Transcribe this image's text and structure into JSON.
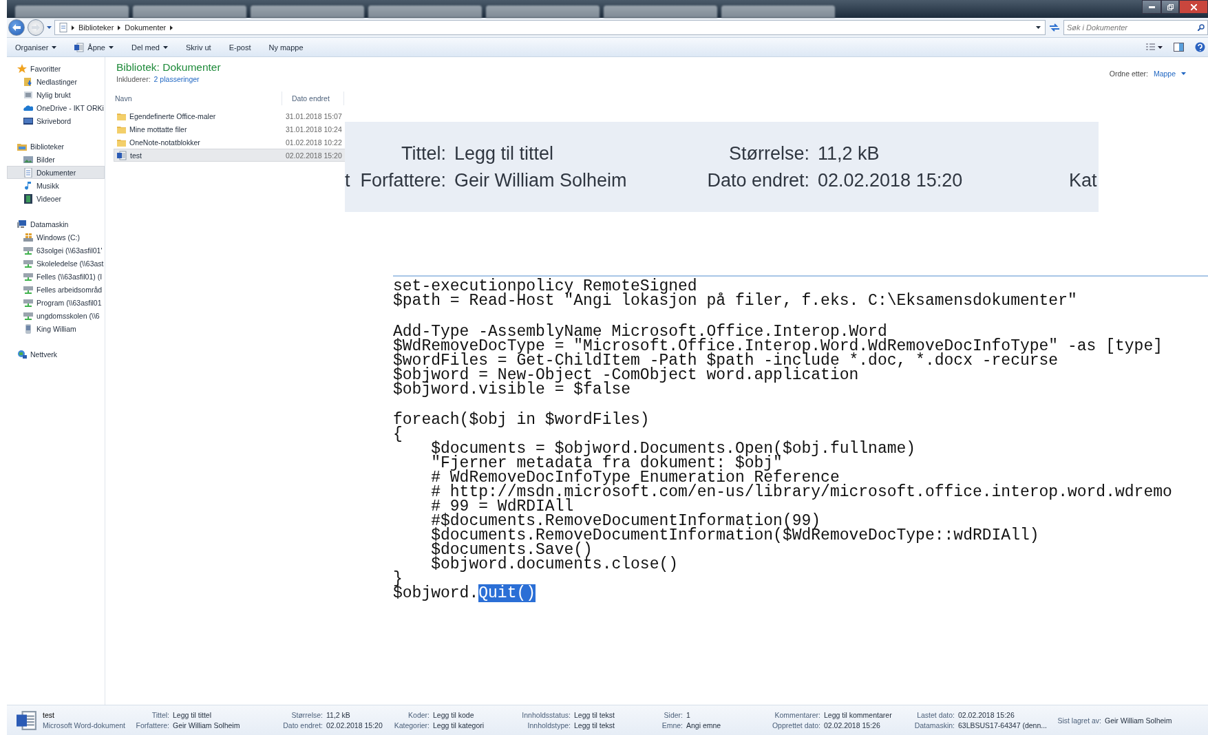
{
  "address_bar": {
    "breadcrumbs": [
      "Biblioteker",
      "Dokumenter"
    ],
    "search": {
      "placeholder": "Søk i Dokumenter"
    }
  },
  "toolbar": {
    "buttons": [
      {
        "label": "Organiser",
        "kind": "menu"
      },
      {
        "label": "Åpne",
        "kind": "app-menu"
      },
      {
        "label": "Del med",
        "kind": "menu"
      },
      {
        "label": "Skriv ut",
        "kind": "plain"
      },
      {
        "label": "E-post",
        "kind": "plain"
      },
      {
        "label": "Ny mappe",
        "kind": "plain"
      }
    ]
  },
  "sidebar": {
    "groups": [
      {
        "label": "Favoritter",
        "kind": "favorites",
        "children": [
          {
            "label": "Nedlastinger",
            "kind": "downloads",
            "selected": false
          },
          {
            "label": "Nylig brukt",
            "kind": "recent",
            "selected": false
          },
          {
            "label": "OneDrive - IKT ORKi",
            "kind": "cloud",
            "selected": false
          },
          {
            "label": "Skrivebord",
            "kind": "desktop",
            "selected": false
          }
        ]
      },
      {
        "label": "Biblioteker",
        "kind": "libraries",
        "children": [
          {
            "label": "Bilder",
            "kind": "pictures",
            "selected": false
          },
          {
            "label": "Dokumenter",
            "kind": "documents",
            "selected": true
          },
          {
            "label": "Musikk",
            "kind": "music",
            "selected": false
          },
          {
            "label": "Videoer",
            "kind": "videos",
            "selected": false
          }
        ]
      },
      {
        "label": "Datamaskin",
        "kind": "computer",
        "children": [
          {
            "label": "Windows (C:)",
            "kind": "drive",
            "selected": false
          },
          {
            "label": "63solgei (\\\\63asfil01'",
            "kind": "network-drive",
            "selected": false
          },
          {
            "label": "Skoleledelse (\\\\63ast",
            "kind": "network-drive",
            "selected": false
          },
          {
            "label": "Felles (\\\\63asfil01) (I",
            "kind": "network-drive",
            "selected": false
          },
          {
            "label": "Felles arbeidsområd",
            "kind": "network-drive",
            "selected": false
          },
          {
            "label": "Program (\\\\63asfil01",
            "kind": "network-drive",
            "selected": false
          },
          {
            "label": "ungdomsskolen (\\\\6",
            "kind": "network-drive",
            "selected": false
          },
          {
            "label": "King William",
            "kind": "device",
            "selected": false
          }
        ]
      },
      {
        "label": "Nettverk",
        "kind": "network"
      }
    ]
  },
  "library": {
    "title": "Bibliotek: Dokumenter",
    "includes_label": "Inkluderer:",
    "includes_link": "2 plasseringer",
    "arrange_label": "Ordne etter:",
    "arrange_value": "Mappe"
  },
  "file_list": {
    "columns": [
      "Navn",
      "Dato endret"
    ],
    "rows": [
      {
        "name": "Egendefinerte Office-maler",
        "date": "31.01.2018 15:07",
        "kind": "folder",
        "selected": false
      },
      {
        "name": "Mine mottatte filer",
        "date": "31.01.2018 10:24",
        "kind": "folder",
        "selected": false
      },
      {
        "name": "OneNote-notatblokker",
        "date": "01.02.2018 10:22",
        "kind": "folder",
        "selected": false
      },
      {
        "name": "test",
        "date": "02.02.2018 15:20",
        "kind": "document",
        "selected": true
      }
    ]
  },
  "properties_zoom": {
    "rows": [
      {
        "items": [
          {
            "label": "Tittel:",
            "value": "Legg til tittel"
          },
          {
            "label": "Størrelse:",
            "value": "11,2 kB"
          }
        ]
      },
      {
        "lead": "t",
        "items": [
          {
            "label": "Forfattere:",
            "value": "Geir William Solheim"
          },
          {
            "label": "Dato endret:",
            "value": "02.02.2018 15:20"
          }
        ],
        "trail": "Kat"
      }
    ]
  },
  "code": {
    "blocks": [
      [
        {
          "text": "set-executionpolicy RemoteSigned"
        },
        {
          "text": "$path = Read-Host \"Angi lokasjon på filer, f.eks. C:\\Eksamensdokumenter\""
        }
      ],
      [
        {
          "text": "Add-Type -AssemblyName Microsoft.Office.Interop.Word"
        },
        {
          "text": "$WdRemoveDocType = \"Microsoft.Office.Interop.Word.WdRemoveDocInfoType\" -as [type]"
        },
        {
          "text": "$wordFiles = Get-ChildItem -Path $path -include *.doc, *.docx -recurse"
        },
        {
          "text": "$objword = New-Object -ComObject word.application"
        },
        {
          "text": "$objword.visible = $false"
        }
      ],
      [
        {
          "text": "foreach($obj in $wordFiles)"
        },
        {
          "text": "{"
        },
        {
          "text": "    $documents = $objword.Documents.Open($obj.fullname)"
        },
        {
          "text": "    \"Fjerner metadata fra dokument: $obj\""
        },
        {
          "text": "    # WdRemoveDocInfoType Enumeration Reference"
        },
        {
          "text": "    # http://msdn.microsoft.com/en-us/library/microsoft.office.interop.word.wdremo"
        },
        {
          "text": "    # 99 = WdRDIAll"
        },
        {
          "text": "    #$documents.RemoveDocumentInformation(99)"
        },
        {
          "text": "    $documents.RemoveDocumentInformation($WdRemoveDocType::wdRDIAll)"
        },
        {
          "text": "    $documents.Save()"
        },
        {
          "text": "    $objword.documents.close()"
        },
        {
          "text": "}"
        },
        {
          "text": "$objword.",
          "highlight": "Quit()"
        }
      ]
    ]
  },
  "details_bar": {
    "name": "test",
    "type": "Microsoft Word-dokument",
    "columns": [
      [
        {
          "label": "Tittel:",
          "value": "Legg til tittel"
        },
        {
          "label": "Forfattere:",
          "value": "Geir William Solheim"
        }
      ],
      [
        {
          "label": "Størrelse:",
          "value": "11,2 kB"
        },
        {
          "label": "Dato endret:",
          "value": "02.02.2018 15:20"
        }
      ],
      [
        {
          "label": "Koder:",
          "value": "Legg til kode"
        },
        {
          "label": "Kategorier:",
          "value": "Legg til kategori"
        }
      ],
      [
        {
          "label": "Innholdsstatus:",
          "value": "Legg til tekst"
        },
        {
          "label": "Innholdstype:",
          "value": "Legg til tekst"
        }
      ],
      [
        {
          "label": "Sider:",
          "value": "1"
        },
        {
          "label": "Emne:",
          "value": "Angi emne"
        }
      ],
      [
        {
          "label": "Kommentarer:",
          "value": "Legg til kommentarer"
        },
        {
          "label": "Opprettet dato:",
          "value": "02.02.2018 15:26"
        }
      ],
      [
        {
          "label": "Lastet dato:",
          "value": "02.02.2018 15:26"
        },
        {
          "label": "Datamaskin:",
          "value": "63LBSUS17-64347 (denn..."
        }
      ],
      [
        {
          "label": "Sist lagret av:",
          "value": "Geir William Solheim"
        }
      ]
    ]
  }
}
